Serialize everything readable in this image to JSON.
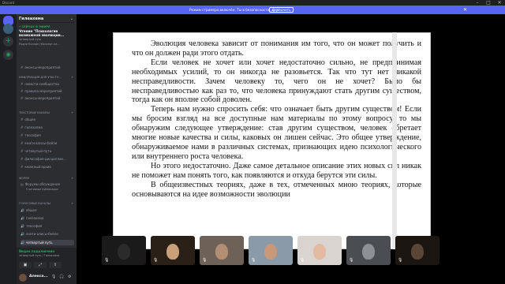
{
  "window": {
    "app_name": "Discord",
    "minimize": "–",
    "maximize": "□",
    "close": "✕"
  },
  "notice": {
    "text": "Режим стримера включён. Ты в безопасности, друг.",
    "button": "Отключить",
    "close": "✕"
  },
  "server": {
    "name": "Гилеахема",
    "chevron": "⌄"
  },
  "live": {
    "tag": "• СЕЙЧАС В ЭФИРЕ",
    "title": "Чтение \"Психология возможной эволюции...",
    "sub1": "четвертый путь",
    "sub2": "Родни Коллин (Мансерт-кл..."
  },
  "categories": {
    "info": {
      "label": "ИНФОРМАЦИЯ ДЛЯ УЧАСТН...",
      "plus": "+"
    },
    "text": {
      "label": "ТЕКСТОВЫЕ КАНАЛЫ",
      "plus": "+"
    },
    "forums": {
      "label": "ФОРУМ",
      "plus": "+"
    },
    "voice": {
      "label": "ГОЛОСОВЫЕ КАНАЛЫ",
      "plus": "+"
    }
  },
  "channels_top": [
    "анонсы-мероприятий"
  ],
  "channels_info": [
    "новости-сообщества",
    "правила-мероприятий",
    "анонсы-мероприятий"
  ],
  "channels_text": [
    "общее",
    "гилеахема",
    "теософия",
    "книги-алисы-бейли",
    "четвертый-путь",
    "философия-дисциплин...",
    "книжный-архив"
  ],
  "forum": {
    "label": "Форумы обсуждения",
    "sub": "5 активные публикации"
  },
  "channels_voice": [
    "общее",
    "гилеахема",
    "теософия",
    "книги-алисы-бейли",
    "четвертый путь"
  ],
  "voice_panel": {
    "status": "Видео подключено",
    "sub": "четвертый путь / Гилеахема",
    "btn1": "▣",
    "btn2": "⤢",
    "btn3": "⇪"
  },
  "user": {
    "name": "Алекса...",
    "mic": "🎙",
    "headset": "🎧",
    "settings": "⚙"
  },
  "document": {
    "paragraphs": [
      "Эволюция человека зависит от понимания им того, что он может получить и что он должен ради этого отдать.",
      "Если человек не хочет или хочет недостаточно сильно, не предпринимая необходимых усилий, то он никогда не разовьется. Так что тут нет никакой несправедливости. Зачем человеку то, чего он не хочет? Было бы несправедливостью как раз то, что человека принуждают стать другим существом, тогда как он вполне собой доволен.",
      "Теперь нам нужно спросить себя: что означает быть другим существом! Если мы бросим взгляд на все доступные нам материалы по этому вопросу, то мы обнаружим следующее утверждение: став другим существом, человек обретает многие новые качества и силы, каковых он лишен сейчас. Это общее утверждение, обнаруживаемое нами в различных системах, признающих идею психологического или внутреннего роста человека.",
      "Но этого недостаточно. Даже самое детальное описание этих новых сил никак не поможет нам понять того, как появляются и откуда берутся эти силы.",
      "В общеизвестных теориях, даже в тех, отмеченных мною теориях, которые основываются на идее возможности эволюции"
    ]
  },
  "tiles": [
    {
      "id": "t1",
      "bg": "#1a1a1a",
      "face": "#2b2b2b"
    },
    {
      "id": "t2",
      "bg": "#2a2018",
      "face": "#c9a07a"
    },
    {
      "id": "t3",
      "bg": "#6e6258",
      "face": "#b38e72"
    },
    {
      "id": "t4",
      "bg": "#8a9aa8",
      "face": "#c7987a"
    },
    {
      "id": "t5",
      "bg": "#d9d4cf",
      "face": "#e3b9a0"
    },
    {
      "id": "t6",
      "bg": "#4a4d52",
      "face": "#8d9196"
    },
    {
      "id": "t7",
      "bg": "#1c1612",
      "face": "#5a4636"
    }
  ],
  "colors": {
    "accent": "#5865f2",
    "online": "#23a55a"
  }
}
